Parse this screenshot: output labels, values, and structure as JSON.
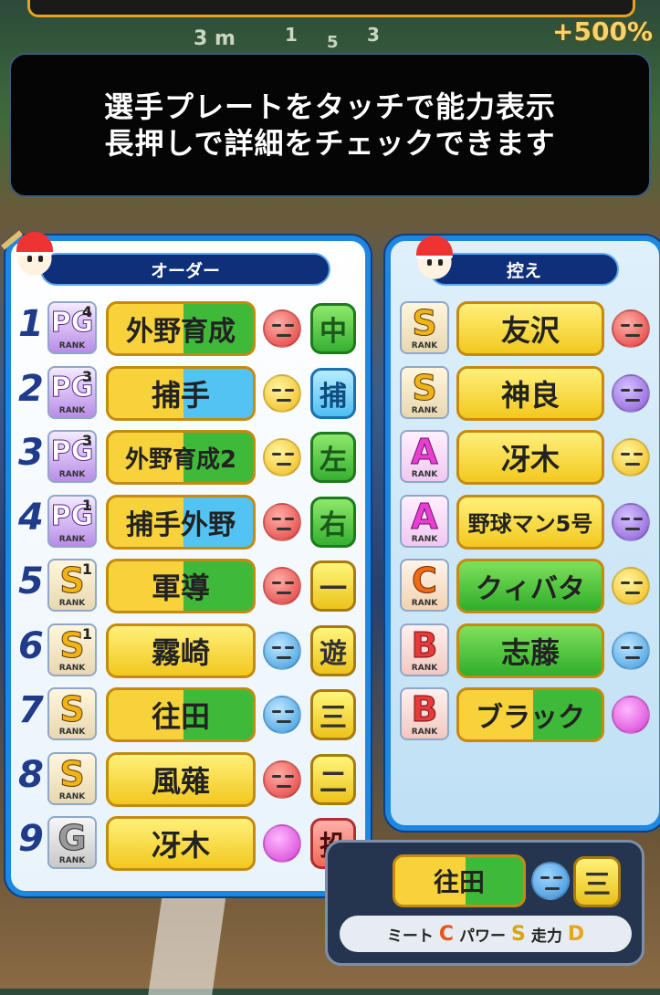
{
  "background": {
    "distance_label": "3 m",
    "counter_1": "1",
    "counter_2": "5",
    "counter_3": "3",
    "bonus": "+500%"
  },
  "message": {
    "line1": "選手プレートをタッチで能力表示",
    "line2": "長押しで詳細をチェックできます"
  },
  "order": {
    "title": "オーダー",
    "rows": [
      {
        "num": "1",
        "rank": "PG",
        "sub": "4",
        "name": "外野育成",
        "pos": "中",
        "mood": "bad",
        "plate": "green-yellow",
        "pos_color": "green"
      },
      {
        "num": "2",
        "rank": "PG",
        "sub": "3",
        "name": "捕手",
        "pos": "捕",
        "mood": "normal",
        "plate": "blue-yellow",
        "pos_color": "blue"
      },
      {
        "num": "3",
        "rank": "PG",
        "sub": "3",
        "name": "外野育成2",
        "pos": "左",
        "mood": "normal",
        "plate": "green-yellow",
        "pos_color": "green"
      },
      {
        "num": "4",
        "rank": "PG",
        "sub": "1",
        "name": "捕手外野",
        "pos": "右",
        "mood": "bad",
        "plate": "blue-yellow",
        "pos_color": "green"
      },
      {
        "num": "5",
        "rank": "S",
        "sub": "1",
        "name": "軍導",
        "pos": "一",
        "mood": "bad",
        "plate": "green-yellow",
        "pos_color": "yellow"
      },
      {
        "num": "6",
        "rank": "S",
        "sub": "1",
        "name": "霧崎",
        "pos": "遊",
        "mood": "very-bad",
        "plate": "yellow",
        "pos_color": "yellow"
      },
      {
        "num": "7",
        "rank": "S",
        "sub": "",
        "name": "往田",
        "pos": "三",
        "mood": "very-bad",
        "plate": "green-yellow",
        "pos_color": "yellow"
      },
      {
        "num": "8",
        "rank": "S",
        "sub": "",
        "name": "風薙",
        "pos": "二",
        "mood": "bad",
        "plate": "yellow",
        "pos_color": "yellow"
      },
      {
        "num": "9",
        "rank": "G",
        "sub": "",
        "name": "冴木",
        "pos": "投",
        "mood": "great",
        "plate": "yellow",
        "pos_color": "red"
      }
    ]
  },
  "bench": {
    "title": "控え",
    "rows": [
      {
        "rank": "S",
        "name": "友沢",
        "mood": "bad",
        "plate": "yellow"
      },
      {
        "rank": "S",
        "name": "神良",
        "mood": "terrible",
        "plate": "yellow"
      },
      {
        "rank": "A",
        "name": "冴木",
        "mood": "normal",
        "plate": "yellow"
      },
      {
        "rank": "A",
        "name": "野球マン5号",
        "mood": "terrible",
        "plate": "yellow"
      },
      {
        "rank": "C",
        "name": "クィバタ",
        "mood": "normal",
        "plate": "green"
      },
      {
        "rank": "B",
        "name": "志藤",
        "mood": "very-bad",
        "plate": "green"
      },
      {
        "rank": "B",
        "name": "ブラック",
        "mood": "great",
        "plate": "green-yellow"
      }
    ]
  },
  "rank_label": "RANK",
  "detail": {
    "name": "往田",
    "pos": "三",
    "meet_label": "ミート",
    "meet": "C",
    "power_label": "パワー",
    "power": "S",
    "run_label": "走力",
    "run": "D"
  },
  "colors": {
    "panel_border": "#1e88e0",
    "title_bg": "#0e2f7a",
    "plate_yellow": "#f7d23a",
    "plate_green": "#3fb93a",
    "plate_blue": "#52c3f2"
  }
}
